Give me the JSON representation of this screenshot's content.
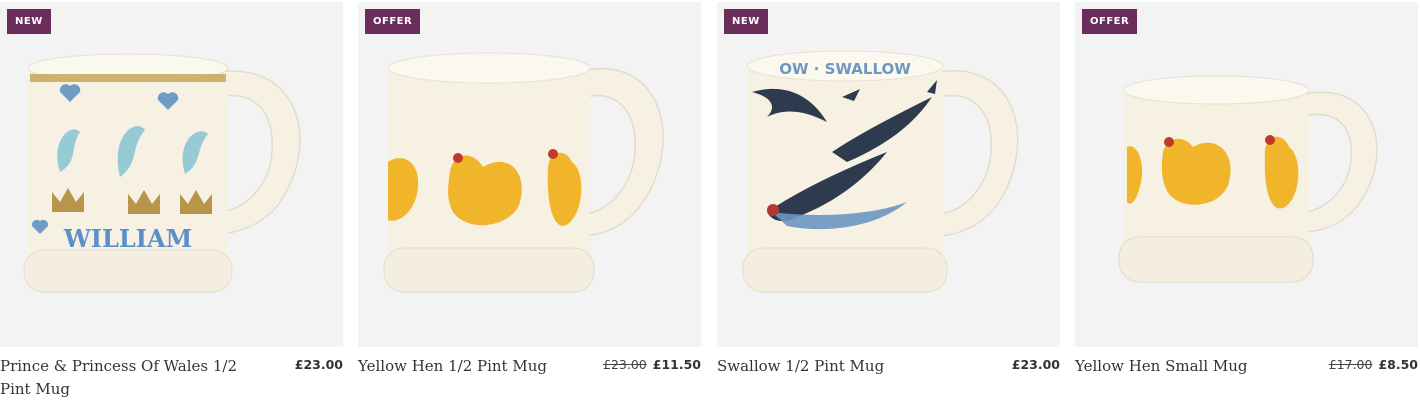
{
  "products": [
    {
      "badge": "NEW",
      "name": "Prince & Princess Of Wales 1/2 Pint Mug",
      "price": "£23.00",
      "mug_text": "WILLIAM",
      "image": "mug-william-crowns"
    },
    {
      "badge": "OFFER",
      "name": "Yellow Hen 1/2 Pint Mug",
      "was_price": "£23.00",
      "price": "£11.50",
      "image": "mug-yellow-hen"
    },
    {
      "badge": "NEW",
      "name": "Swallow 1/2 Pint Mug",
      "price": "£23.00",
      "mug_text": "OW · SWALLOW",
      "image": "mug-swallow"
    },
    {
      "badge": "OFFER",
      "name": "Yellow Hen Small Mug",
      "was_price": "£17.00",
      "price": "£8.50",
      "image": "mug-yellow-hen-small"
    }
  ],
  "colors": {
    "badge_bg": "#6b2d5b",
    "image_bg": "#f3f3f3",
    "mug_cream": "#f6f1e3",
    "hen_yellow": "#f0b52a",
    "william_blue": "#5b8fc7"
  }
}
